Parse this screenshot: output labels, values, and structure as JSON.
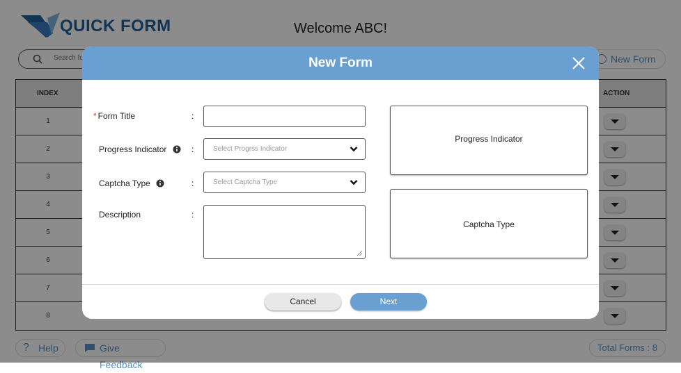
{
  "app": {
    "logo_text": "QUICK FORM",
    "welcome": "Welcome ABC!",
    "search_placeholder": "Search fo",
    "new_form_label": "New Form",
    "table": {
      "headers": {
        "index": "INDEX",
        "action": "ACTION"
      },
      "rows": [
        "1",
        "2",
        "3",
        "4",
        "5",
        "6",
        "7",
        "8"
      ]
    },
    "help_label": "Help",
    "feedback_label": "Give Feedback",
    "total_forms": "Total Forms : 8"
  },
  "modal": {
    "title": "New Form",
    "fields": {
      "form_title_label": "Form Title",
      "progress_label": "Progress Indicator",
      "progress_placeholder": "Select Progrss Indicator",
      "captcha_label": "Captcha Type",
      "captcha_placeholder": "Select Captcha Type",
      "description_label": "Description",
      "colon": ":"
    },
    "preview": {
      "progress": "Progress Indicator",
      "captcha": "Captcha Type"
    },
    "buttons": {
      "cancel": "Cancel",
      "next": "Next"
    }
  },
  "colors": {
    "header_blue": "#6a9fd2",
    "accent_blue": "#5b8fc8",
    "required_red": "#e03a3a"
  }
}
